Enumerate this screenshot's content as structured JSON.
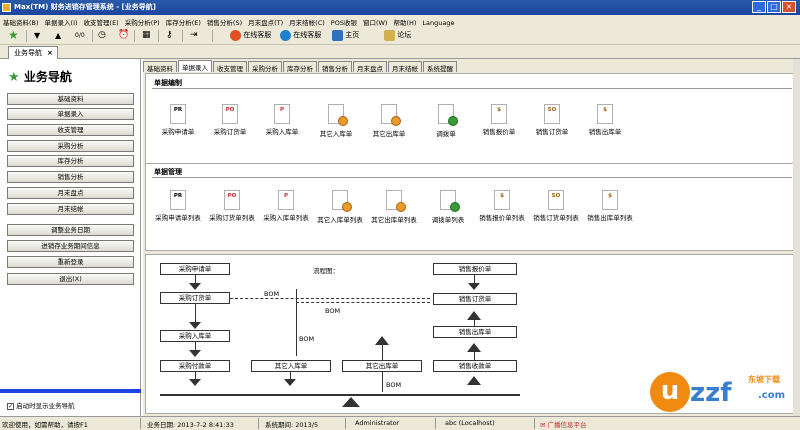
{
  "window": {
    "title": "Max(TM) 财务进销存管理系统 - [业务导航]",
    "buttons": {
      "minimize": "_",
      "maximize": "□",
      "close": "×"
    }
  },
  "menu": [
    "基础资料(B)",
    "单据录入(I)",
    "收支管理(E)",
    "采购分析(P)",
    "库存分析(E)",
    "销售分析(S)",
    "月末盘点(T)",
    "月末结帐(C)",
    "POS收银",
    "窗口(W)",
    "帮助(H)",
    "Language"
  ],
  "toolbar": {
    "online_service_1": "在线客服",
    "online_service_2": "在线客服",
    "homepage": "主页",
    "forum": "论坛",
    "colors": {
      "star": "#3a9a3a",
      "service": "#2060c0"
    }
  },
  "doc_tab": {
    "label": "业务导航",
    "close": "×"
  },
  "sidebar": {
    "title": "业务导航",
    "buttons": [
      "基础资料",
      "单据录入",
      "收支管理",
      "采购分析",
      "库存分析",
      "销售分析",
      "月末盘点",
      "月末结帐"
    ],
    "buttons2": [
      "调整业务日期",
      "进销存业务期间信息",
      "重新登录",
      "退出(X)"
    ],
    "checkbox_label": "启动时显示业务导航",
    "checkbox_checked": true
  },
  "content_tabs": [
    "基础资料",
    "单据录入",
    "收支管理",
    "采购分析",
    "库存分析",
    "销售分析",
    "月末盘点",
    "月末结帐",
    "系统提醒"
  ],
  "active_tab": "单据录入",
  "sections": {
    "edit": {
      "title": "单据编制",
      "items": [
        {
          "label": "采购申请单",
          "code": "PR",
          "icon": "doc-pr-icon"
        },
        {
          "label": "采购订货单",
          "code": "PO",
          "icon": "doc-po-icon"
        },
        {
          "label": "采购入库单",
          "code": "P",
          "icon": "doc-p-icon"
        },
        {
          "label": "其它入库单",
          "code": "",
          "icon": "doc-in-icon"
        },
        {
          "label": "其它出库单",
          "code": "",
          "icon": "doc-out-icon"
        },
        {
          "label": "调拨单",
          "code": "",
          "icon": "doc-transfer-icon"
        },
        {
          "label": "销售报价单",
          "code": "$",
          "icon": "doc-quote-icon"
        },
        {
          "label": "销售订货单",
          "code": "SO",
          "icon": "doc-so-icon"
        },
        {
          "label": "销售出库单",
          "code": "$",
          "icon": "doc-sales-out-icon"
        }
      ]
    },
    "manage": {
      "title": "单据管理",
      "items": [
        {
          "label": "采购申请单列表",
          "code": "PR",
          "icon": "doc-pr-list-icon"
        },
        {
          "label": "采购订货单列表",
          "code": "PO",
          "icon": "doc-po-list-icon"
        },
        {
          "label": "采购入库单列表",
          "code": "P",
          "icon": "doc-p-list-icon"
        },
        {
          "label": "其它入库单列表",
          "code": "",
          "icon": "doc-in-list-icon"
        },
        {
          "label": "其它出库单列表",
          "code": "",
          "icon": "doc-out-list-icon"
        },
        {
          "label": "调拨单列表",
          "code": "",
          "icon": "doc-transfer-list-icon"
        },
        {
          "label": "销售报价单列表",
          "code": "$",
          "icon": "doc-quote-list-icon"
        },
        {
          "label": "销售订货单列表",
          "code": "SO",
          "icon": "doc-so-list-icon"
        },
        {
          "label": "销售出库单列表",
          "code": "$",
          "icon": "doc-sales-out-list-icon"
        }
      ]
    }
  },
  "flowchart": {
    "title": "流程图：",
    "boxes": {
      "purchase_request": "采购申请单",
      "purchase_order": "采购订货单",
      "purchase_receipt": "采购入库单",
      "purchase_payment": "采购付款单",
      "other_in": "其它入库单",
      "other_out": "其它出库单",
      "sales_quote": "销售报价单",
      "sales_order": "销售订货单",
      "sales_out": "销售出库单",
      "sales_receipt": "销售收款单"
    },
    "bom_labels": [
      "BOM",
      "BOM",
      "BOM",
      "BOM"
    ]
  },
  "status": {
    "welcome": "欢迎使用，如需帮助，请按F1",
    "business_date": "业务日期: 2013-7-2 8:41:33",
    "period": "系统期间: 2013/5",
    "user": "Administrator",
    "server": "abc (Localhost)",
    "ad": "广播信息平台"
  },
  "watermark": "uzzf.com 东坡下载"
}
